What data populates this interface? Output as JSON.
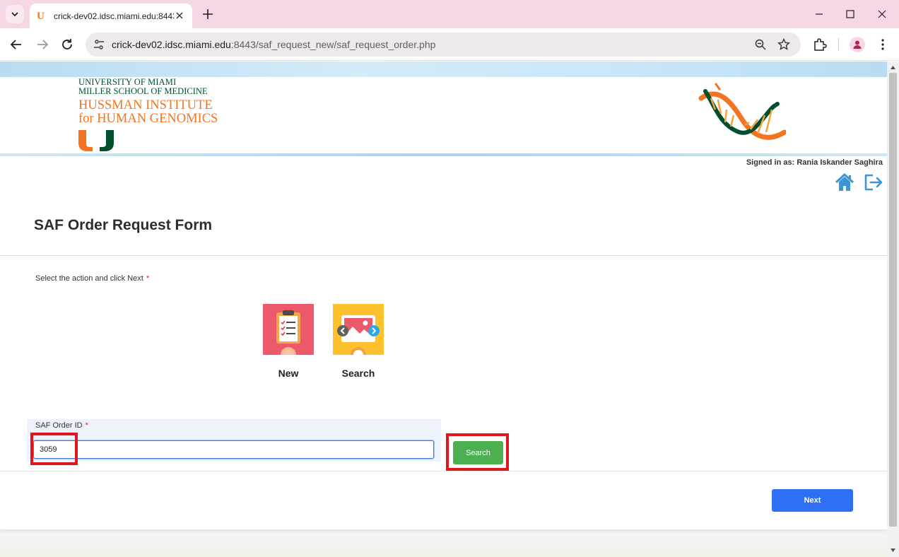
{
  "browser": {
    "tab_title": "crick-dev02.idsc.miami.edu:8443",
    "url_host": "crick-dev02.idsc.miami.edu",
    "url_rest": ":8443/saf_request_new/saf_request_order.php"
  },
  "header": {
    "university": "UNIVERSITY OF MIAMI",
    "school": "MILLER SCHOOL OF MEDICINE",
    "institute_line1": "HUSSMAN INSTITUTE",
    "institute_line2": "for HUMAN GENOMICS"
  },
  "user": {
    "signed_in": "Signed in as: Rania Iskander Saghira"
  },
  "form": {
    "title": "SAF Order Request Form",
    "action_label": "Select the action and click Next",
    "required_mark": "*",
    "options": [
      {
        "label": "New"
      },
      {
        "label": "Search"
      }
    ],
    "order_id_label": "SAF Order ID",
    "order_id_value": "3059",
    "search_button": "Search",
    "next_button": "Next"
  },
  "colors": {
    "um_green": "#005030",
    "um_orange": "#f47321",
    "search_green": "#4caf50",
    "next_blue": "#2f6ff5",
    "highlight_red": "#e0161e"
  }
}
